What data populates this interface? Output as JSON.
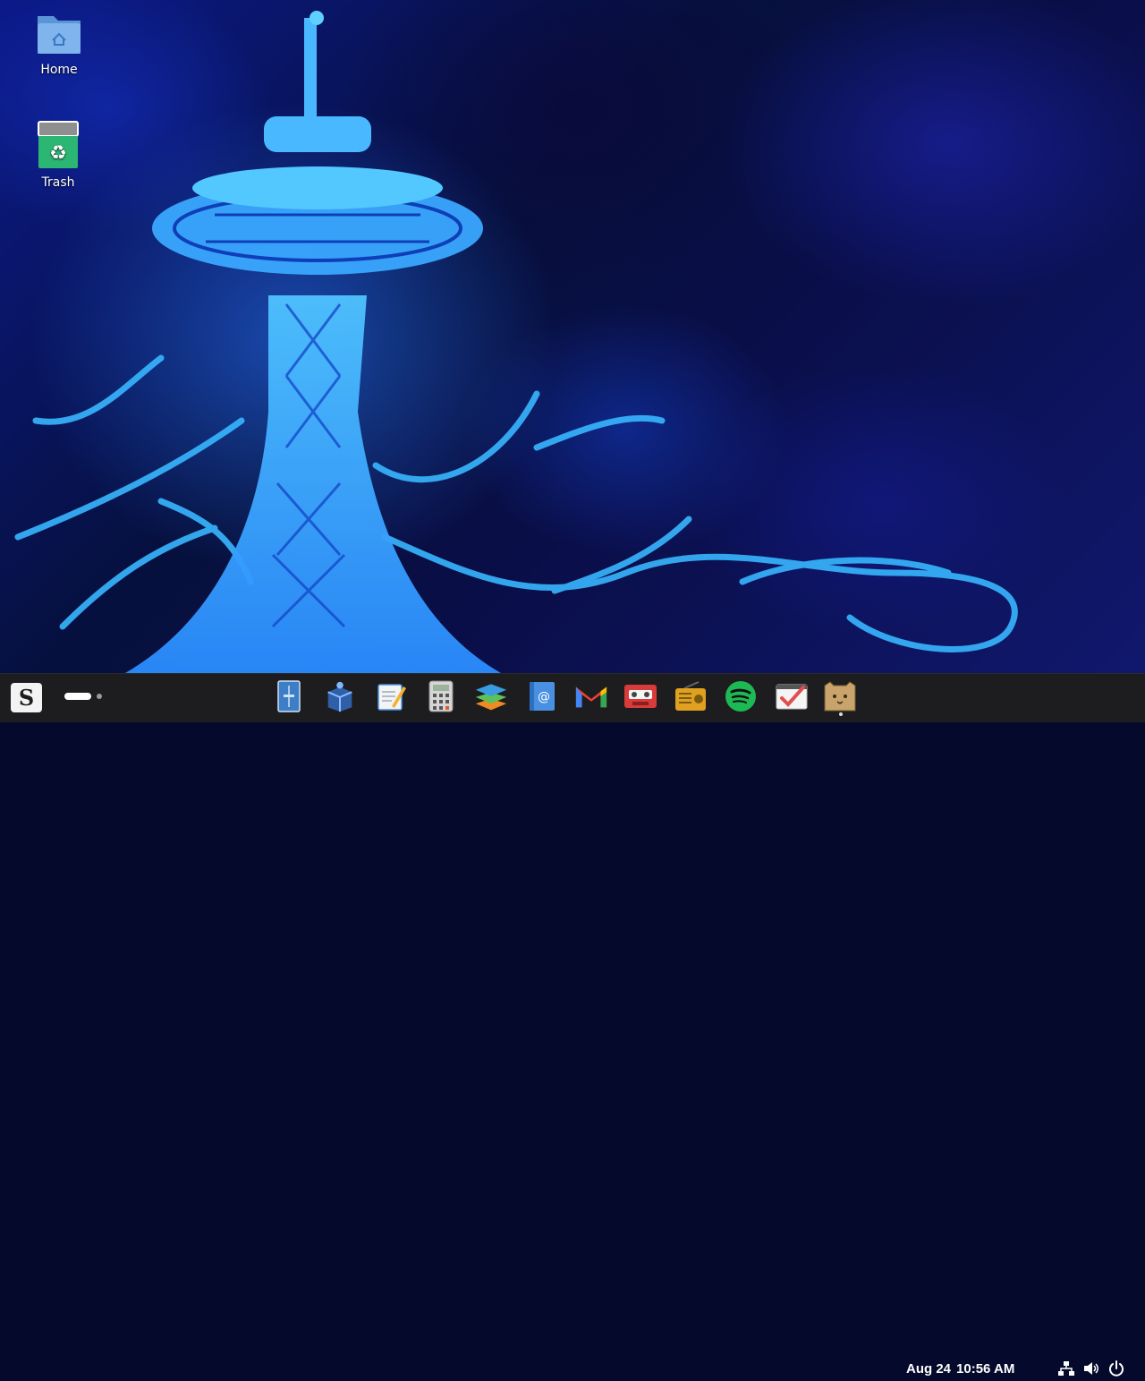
{
  "desktop": {
    "icons": [
      {
        "label": "Home",
        "icon": "folder-home-icon",
        "color": "#6aa7e8"
      },
      {
        "label": "Trash",
        "icon": "trash-icon",
        "color": "#2bb673"
      }
    ]
  },
  "taskbar": {
    "start_label": "S",
    "dock": [
      {
        "icon": "file-manager-icon",
        "color": "#3e7ec6"
      },
      {
        "icon": "software-store-icon",
        "color": "#4f8fd8"
      },
      {
        "icon": "text-editor-icon",
        "color": "#f2b233"
      },
      {
        "icon": "calculator-icon",
        "color": "#c9c9c9"
      },
      {
        "icon": "layers-app-icon",
        "color": "#5bc25b"
      },
      {
        "icon": "mail-client-icon",
        "color": "#4a90e2"
      },
      {
        "icon": "gmail-icon",
        "color": "#ea4335"
      },
      {
        "icon": "cassette-player-icon",
        "color": "#d93a3a"
      },
      {
        "icon": "radio-icon",
        "color": "#e0a020"
      },
      {
        "icon": "spotify-icon",
        "color": "#1db954"
      },
      {
        "icon": "tasks-checklist-icon",
        "color": "#e24d4d"
      },
      {
        "icon": "pet-companion-icon",
        "color": "#c8a36b"
      }
    ],
    "clock": {
      "date": "Aug 24",
      "time": "10:56 AM"
    },
    "tray": [
      {
        "icon": "network-icon"
      },
      {
        "icon": "volume-icon"
      },
      {
        "icon": "power-icon"
      }
    ]
  }
}
